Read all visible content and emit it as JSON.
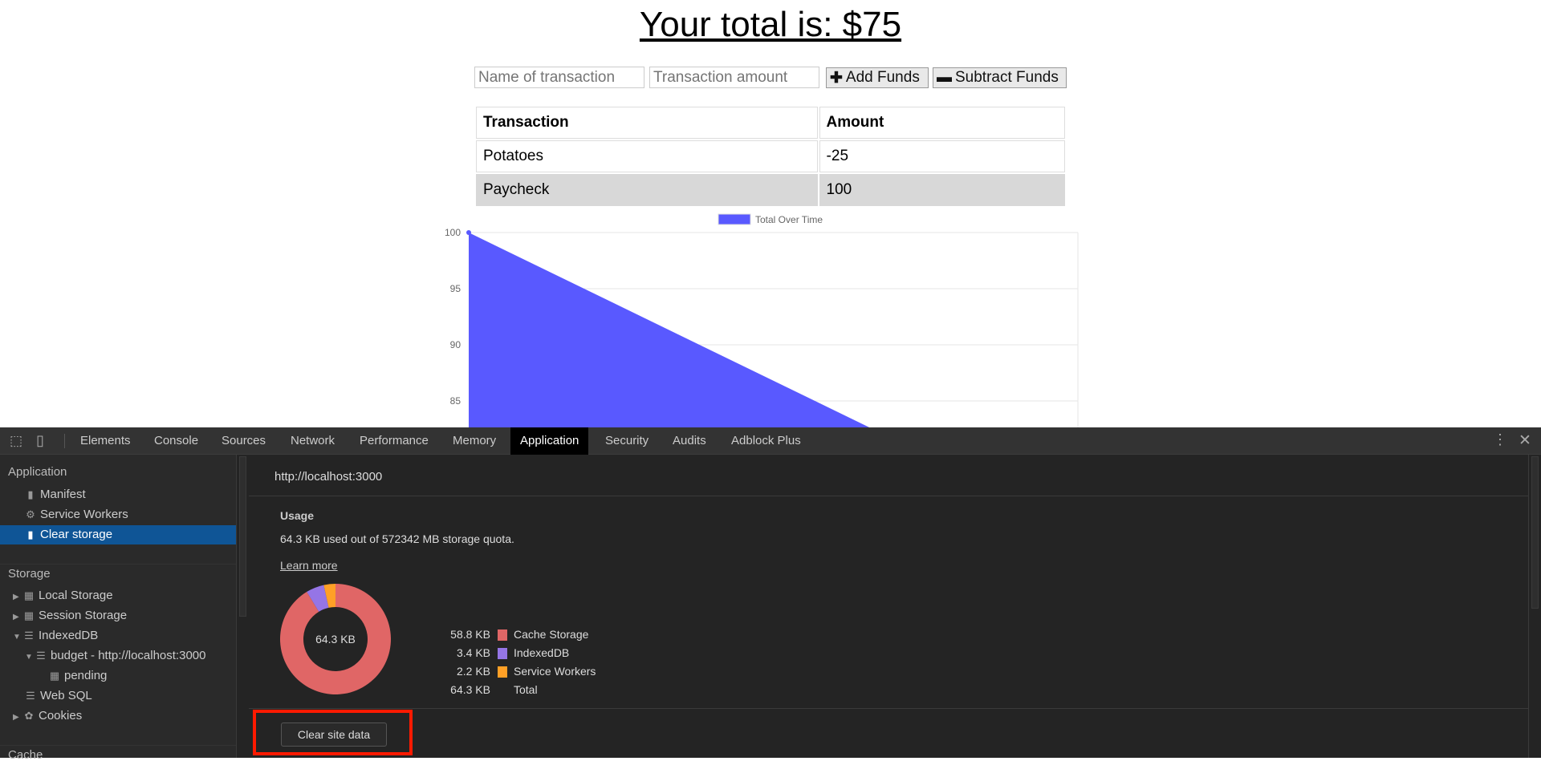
{
  "page": {
    "title": "Your total is: $75",
    "name_placeholder": "Name of transaction",
    "amount_placeholder": "Transaction amount",
    "add_label": "Add Funds",
    "subtract_label": "Subtract Funds",
    "table": {
      "headers": [
        "Transaction",
        "Amount"
      ],
      "rows": [
        [
          "Potatoes",
          "-25"
        ],
        [
          "Paycheck",
          "100"
        ]
      ]
    }
  },
  "chart_data": {
    "type": "area",
    "legend": "Total Over Time",
    "legend_position": "top",
    "series": [
      {
        "name": "Total Over Time",
        "values": [
          100,
          75
        ],
        "color": "#5959ff"
      }
    ],
    "y_ticks": [
      "100",
      "95",
      "90",
      "85"
    ],
    "ylim_visible": [
      83,
      100
    ],
    "grid": true
  },
  "devtools": {
    "tabs": [
      "Elements",
      "Console",
      "Sources",
      "Network",
      "Performance",
      "Memory",
      "Application",
      "Security",
      "Audits",
      "Adblock Plus"
    ],
    "active_tab": "Application",
    "sidebar": {
      "application_header": "Application",
      "app_items": [
        "Manifest",
        "Service Workers",
        "Clear storage"
      ],
      "storage_header": "Storage",
      "storage_items": [
        "Local Storage",
        "Session Storage",
        "IndexedDB",
        "budget - http://localhost:3000",
        "pending",
        "Web SQL",
        "Cookies"
      ],
      "cache_header": "Cache"
    },
    "main": {
      "origin": "http://localhost:3000",
      "usage_title": "Usage",
      "usage_text": "64.3 KB used out of 572342 MB storage quota.",
      "learn_more": "Learn more",
      "donut_center": "64.3 KB",
      "legend": [
        {
          "value": "58.8 KB",
          "label": "Cache Storage",
          "color": "#e06666",
          "kb": 58.8
        },
        {
          "value": "3.4 KB",
          "label": "IndexedDB",
          "color": "#9575e6",
          "kb": 3.4
        },
        {
          "value": "2.2 KB",
          "label": "Service Workers",
          "color": "#ffa026",
          "kb": 2.2
        },
        {
          "value": "64.3 KB",
          "label": "Total"
        }
      ],
      "clear_button": "Clear site data",
      "highlight_color": "#ff1a00"
    }
  }
}
